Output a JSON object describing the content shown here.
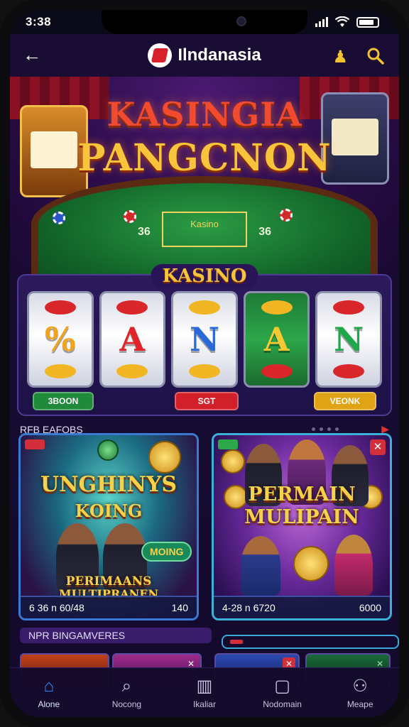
{
  "status": {
    "time": "3:38"
  },
  "header": {
    "brand": "Ilndanasia"
  },
  "hero": {
    "title_line1": "KASINGIA",
    "title_line2": "PANGCNON",
    "table_left_num": "36",
    "table_right_num": "36",
    "table_mark": "Kasino"
  },
  "kasino": {
    "label": "KASINO",
    "reels": [
      "%",
      "A",
      "N",
      "A",
      "N"
    ],
    "buttons": [
      "3BOON",
      "SGT",
      "VEONK"
    ],
    "button_colors": [
      "#1f8a3a",
      "#d2202a",
      "#e0a316"
    ]
  },
  "section1": {
    "title": "RFB EAFOBS"
  },
  "cards": [
    {
      "title_line1": "UNGHINYS",
      "title_line2": "KOING",
      "badge": "MOING",
      "subtitle_line1": "PERIMAANS",
      "subtitle_line2": "MULTIPRANEN",
      "footer_left": "6 36 n 60/48",
      "footer_right": "140"
    },
    {
      "title_line1": "PERMAIN",
      "title_line2": "MULIPAIN",
      "subtitle_line1": "",
      "footer_left": "4-28 n 6720",
      "footer_right": "6000"
    }
  ],
  "section2": {
    "title": "NPR BINGAMVERES"
  },
  "nav": [
    {
      "label": "Alone",
      "icon": "home-icon",
      "glyph": "⌂",
      "active": true
    },
    {
      "label": "Nocong",
      "icon": "search-icon",
      "glyph": "⌕",
      "active": false
    },
    {
      "label": "Ikaliar",
      "icon": "chart-icon",
      "glyph": "▥",
      "active": false
    },
    {
      "label": "Nodomain",
      "icon": "tablet-icon",
      "glyph": "▢",
      "active": false
    },
    {
      "label": "Meape",
      "icon": "profile-icon",
      "glyph": "⚇",
      "active": false
    }
  ]
}
